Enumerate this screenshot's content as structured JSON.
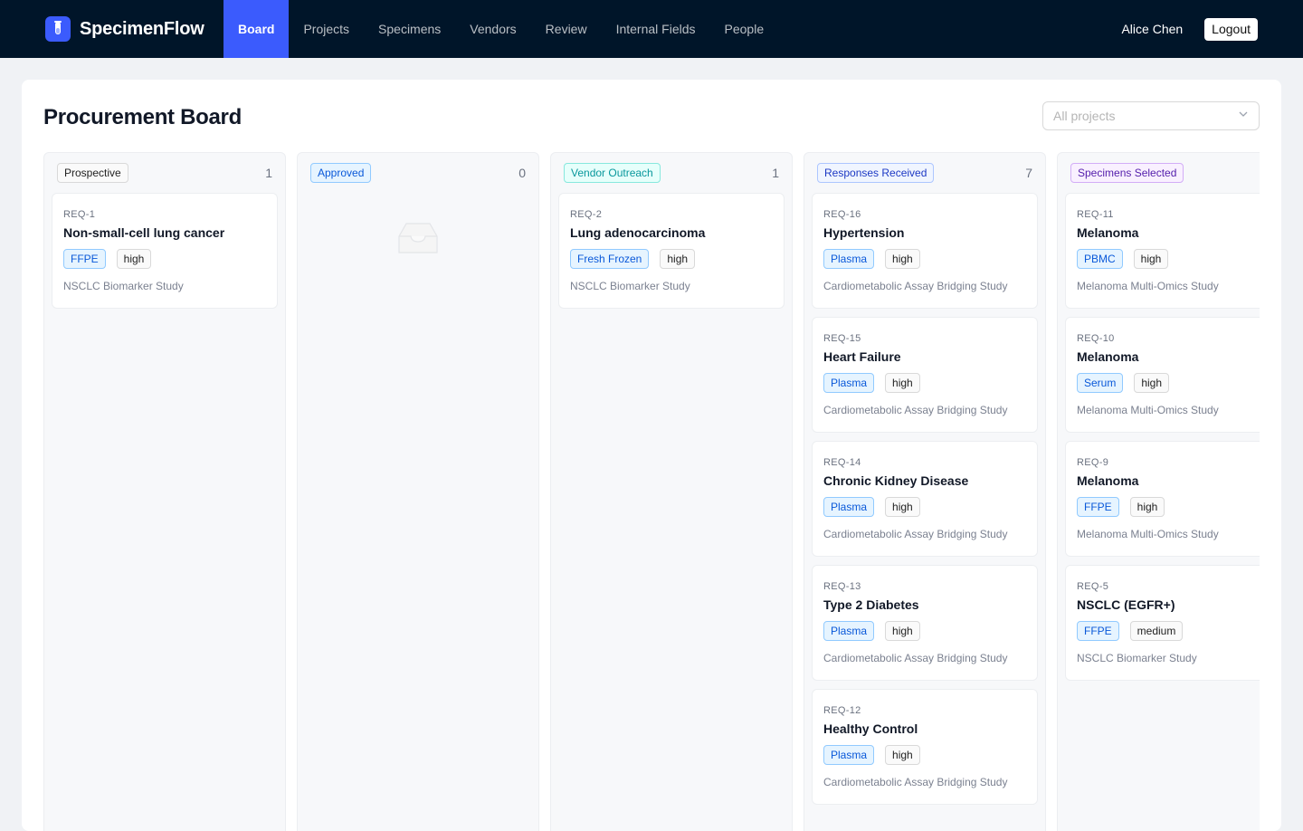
{
  "app": {
    "name": "SpecimenFlow",
    "logo_icon": "test-tube-icon",
    "accent": "#3b5bfd",
    "nav_bg": "#001529"
  },
  "nav": {
    "items": [
      {
        "label": "Board",
        "active": true
      },
      {
        "label": "Projects"
      },
      {
        "label": "Specimens"
      },
      {
        "label": "Vendors"
      },
      {
        "label": "Review"
      },
      {
        "label": "Internal Fields"
      },
      {
        "label": "People"
      }
    ]
  },
  "user": {
    "name": "Alice Chen",
    "logout_label": "Logout"
  },
  "page": {
    "title": "Procurement Board"
  },
  "project_filter": {
    "placeholder": "All projects"
  },
  "columns": [
    {
      "name": "Prospective",
      "count": "1",
      "cards": [
        {
          "id": "REQ-1",
          "title": "Non-small-cell lung cancer",
          "type": "FFPE",
          "priority": "high",
          "project": "NSCLC Biomarker Study"
        }
      ]
    },
    {
      "name": "Approved",
      "count": "0",
      "cards": [],
      "empty_icon": "inbox-icon"
    },
    {
      "name": "Vendor Outreach",
      "count": "1",
      "cards": [
        {
          "id": "REQ-2",
          "title": "Lung adenocarcinoma",
          "type": "Fresh Frozen",
          "priority": "high",
          "project": "NSCLC Biomarker Study"
        }
      ]
    },
    {
      "name": "Responses Received",
      "count": "7",
      "cards": [
        {
          "id": "REQ-16",
          "title": "Hypertension",
          "type": "Plasma",
          "priority": "high",
          "project": "Cardiometabolic Assay Bridging Study"
        },
        {
          "id": "REQ-15",
          "title": "Heart Failure",
          "type": "Plasma",
          "priority": "high",
          "project": "Cardiometabolic Assay Bridging Study"
        },
        {
          "id": "REQ-14",
          "title": "Chronic Kidney Disease",
          "type": "Plasma",
          "priority": "high",
          "project": "Cardiometabolic Assay Bridging Study"
        },
        {
          "id": "REQ-13",
          "title": "Type 2 Diabetes",
          "type": "Plasma",
          "priority": "high",
          "project": "Cardiometabolic Assay Bridging Study"
        },
        {
          "id": "REQ-12",
          "title": "Healthy Control",
          "type": "Plasma",
          "priority": "high",
          "project": "Cardiometabolic Assay Bridging Study"
        }
      ]
    },
    {
      "name": "Specimens Selected",
      "count": "",
      "cards": [
        {
          "id": "REQ-11",
          "title": "Melanoma",
          "type": "PBMC",
          "priority": "high",
          "project": "Melanoma Multi-Omics Study"
        },
        {
          "id": "REQ-10",
          "title": "Melanoma",
          "type": "Serum",
          "priority": "high",
          "project": "Melanoma Multi-Omics Study"
        },
        {
          "id": "REQ-9",
          "title": "Melanoma",
          "type": "FFPE",
          "priority": "high",
          "project": "Melanoma Multi-Omics Study"
        },
        {
          "id": "REQ-5",
          "title": "NSCLC (EGFR+)",
          "type": "FFPE",
          "priority": "medium",
          "project": "NSCLC Biomarker Study"
        }
      ]
    }
  ]
}
